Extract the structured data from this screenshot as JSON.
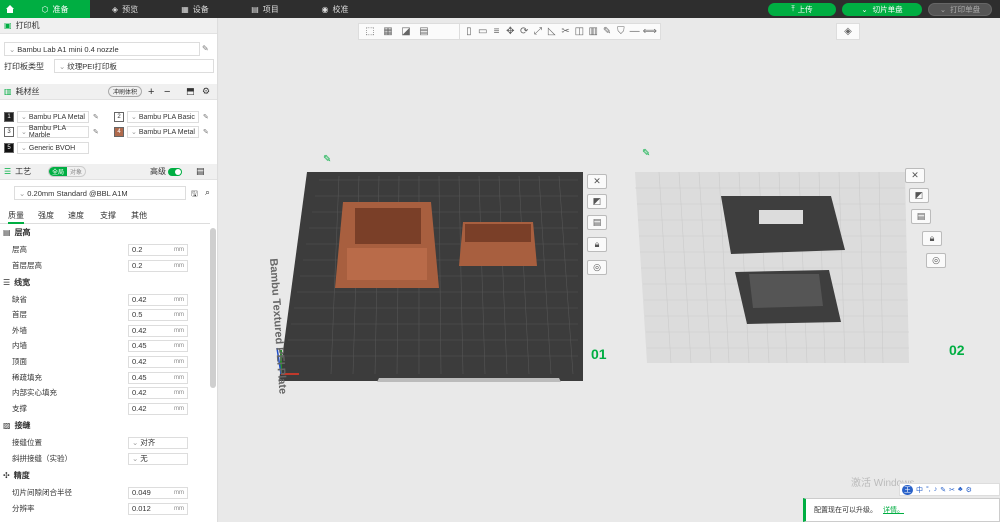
{
  "topbar": {
    "tabs": [
      {
        "label": "准备",
        "icon": "cube-icon"
      },
      {
        "label": "预览",
        "icon": "layers-icon"
      },
      {
        "label": "设备",
        "icon": "device-icon"
      },
      {
        "label": "项目",
        "icon": "project-icon"
      },
      {
        "label": "校准",
        "icon": "calibrate-icon"
      }
    ],
    "upload_label": "上传",
    "slice_label": "切片单盘",
    "print_label": "打印单盘"
  },
  "printer": {
    "section_label": "打印机",
    "printer_name": "Bambu Lab A1 mini 0.4 nozzle",
    "plate_type_label": "打印板类型",
    "plate_type_value": "纹理PEI打印板"
  },
  "filament": {
    "section_label": "耗材丝",
    "flush_label": "冲刷体积",
    "items": [
      {
        "num": "1",
        "name": "Bambu PLA Metal",
        "color": "#222222"
      },
      {
        "num": "2",
        "name": "Bambu PLA Basic",
        "color": "#ffffff"
      },
      {
        "num": "3",
        "name": "Bambu PLA Marble",
        "color": "#ffffff"
      },
      {
        "num": "4",
        "name": "Bambu PLA Metal",
        "color": "#b06a4c"
      },
      {
        "num": "5",
        "name": "Generic BVOH",
        "color": "#111111"
      }
    ]
  },
  "process": {
    "section_label": "工艺",
    "global_label": "全局",
    "object_label": "对象",
    "advanced_label": "高级",
    "profile": "0.20mm Standard @BBL A1M",
    "tabs": [
      "质量",
      "强度",
      "速度",
      "支撑",
      "其他"
    ],
    "groups": [
      {
        "title": "层高",
        "rows": [
          {
            "label": "层高",
            "value": "0.2",
            "unit": "mm"
          },
          {
            "label": "首层层高",
            "value": "0.2",
            "unit": "mm"
          }
        ]
      },
      {
        "title": "线宽",
        "rows": [
          {
            "label": "缺省",
            "value": "0.42",
            "unit": "mm"
          },
          {
            "label": "首层",
            "value": "0.5",
            "unit": "mm"
          },
          {
            "label": "外墙",
            "value": "0.42",
            "unit": "mm"
          },
          {
            "label": "内墙",
            "value": "0.45",
            "unit": "mm"
          },
          {
            "label": "顶面",
            "value": "0.42",
            "unit": "mm"
          },
          {
            "label": "稀疏填充",
            "value": "0.45",
            "unit": "mm"
          },
          {
            "label": "内部实心填充",
            "value": "0.42",
            "unit": "mm"
          },
          {
            "label": "支撑",
            "value": "0.42",
            "unit": "mm"
          }
        ]
      },
      {
        "title": "接缝",
        "rows": [
          {
            "label": "接缝位置",
            "value": "对齐",
            "unit": ""
          },
          {
            "label": "斜拼接缝（实验）",
            "value": "无",
            "unit": ""
          }
        ]
      },
      {
        "title": "精度",
        "rows": [
          {
            "label": "切片间隙闭合半径",
            "value": "0.049",
            "unit": "mm"
          },
          {
            "label": "分辨率",
            "value": "0.012",
            "unit": "mm"
          }
        ]
      }
    ]
  },
  "plates": {
    "plate1_label": "Bambu Textured PEI Plate",
    "plate1_number": "01",
    "plate2_number": "02"
  },
  "system": {
    "watermark": "激活 Windows",
    "toast": "配置现在可以升级。",
    "toast_link": "详情。",
    "ime": "中"
  }
}
